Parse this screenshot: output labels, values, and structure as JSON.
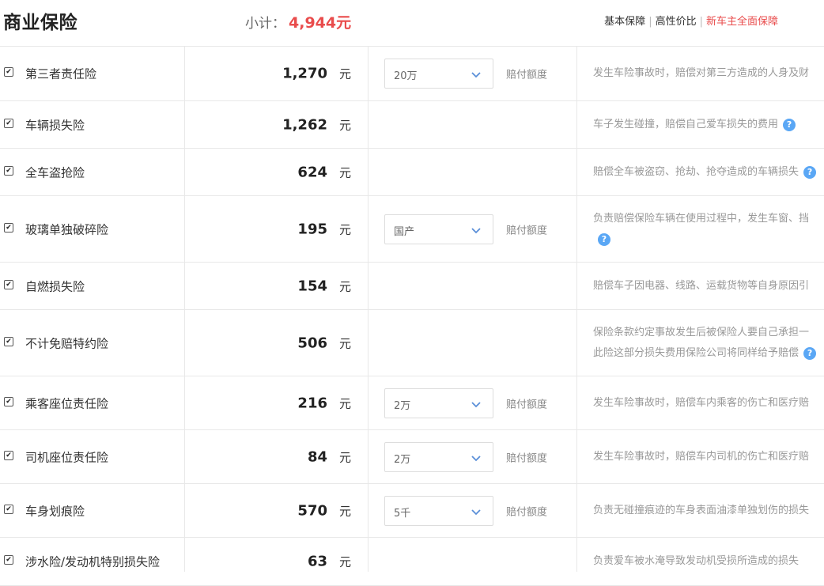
{
  "header": {
    "title": "商业保险",
    "subtotal_label": "小计：",
    "subtotal_value": "4,944元",
    "plans": [
      "基本保障",
      "高性价比",
      "新车主全面保障"
    ]
  },
  "unit": "元",
  "select_label": "赔付额度",
  "help_glyph": "?",
  "rows": [
    {
      "name": "第三者责任险",
      "price": "1,270",
      "select": "20万",
      "desc": [
        "发生车险事故时，赔偿对第三方造成的人身及财"
      ],
      "help": false
    },
    {
      "name": "车辆损失险",
      "price": "1,262",
      "select": null,
      "desc": [
        "车子发生碰撞，赔偿自己爱车损失的费用"
      ],
      "help": true
    },
    {
      "name": "全车盗抢险",
      "price": "624",
      "select": null,
      "desc": [
        "赔偿全车被盗窃、抢劫、抢夺造成的车辆损失"
      ],
      "help": true
    },
    {
      "name": "玻璃单独破碎险",
      "price": "195",
      "select": "国产",
      "desc": [
        "负责赔偿保险车辆在使用过程中，发生车窗、挡",
        ""
      ],
      "help": true
    },
    {
      "name": "自燃损失险",
      "price": "154",
      "select": null,
      "desc": [
        "赔偿车子因电器、线路、运载货物等自身原因引"
      ],
      "help": false
    },
    {
      "name": "不计免赔特约险",
      "price": "506",
      "select": null,
      "desc": [
        "保险条款约定事故发生后被保险人要自己承担一",
        "此险这部分损失费用保险公司将同样给予赔偿"
      ],
      "help": true
    },
    {
      "name": "乘客座位责任险",
      "price": "216",
      "select": "2万",
      "desc": [
        "发生车险事故时，赔偿车内乘客的伤亡和医疗赔"
      ],
      "help": false
    },
    {
      "name": "司机座位责任险",
      "price": "84",
      "select": "2万",
      "desc": [
        "发生车险事故时，赔偿车内司机的伤亡和医疗赔"
      ],
      "help": false
    },
    {
      "name": "车身划痕险",
      "price": "570",
      "select": "5千",
      "desc": [
        "负责无碰撞痕迹的车身表面油漆单独划伤的损失"
      ],
      "help": false
    },
    {
      "name": "涉水险/发动机特别损失险",
      "price": "63",
      "select": null,
      "desc": [
        "负责爱车被水淹导致发动机受损所造成的损失"
      ],
      "help": false
    }
  ]
}
